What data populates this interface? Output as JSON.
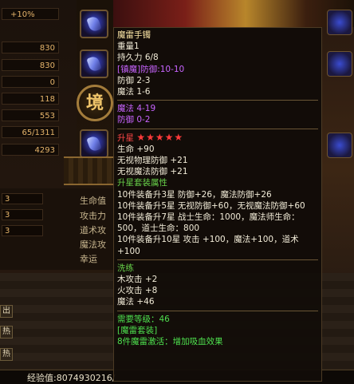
{
  "left_stats": [
    "+10%",
    "830",
    "830",
    "0",
    "118",
    "553",
    "65/1311",
    "4293"
  ],
  "mini_stats": [
    "3",
    "3",
    "3"
  ],
  "stat_labels": [
    "生命值",
    "攻击力",
    "道术攻",
    "魔法攻",
    "幸运"
  ],
  "jing_button": "境",
  "bottom_buttons": [
    "出",
    "热",
    "热"
  ],
  "exp_label": "经验值:8074930216/",
  "tooltip": {
    "name": "魔雷手镯",
    "weight": "重量1",
    "durability": "持久力 6/8",
    "refine": "[镇魔]防御:10-10",
    "defense": "防御 2-3",
    "magic": "魔法 1-6",
    "magic_bonus": "魔法 4-19",
    "defense_bonus": "防御 0-2",
    "upgrade_star_label": "升星",
    "stars": "★★★★★",
    "star_lines": [
      "生命 +90",
      "无视物理防御 +21",
      "无视魔法防御 +21"
    ],
    "set_header": "升星套装属性",
    "set_lines": [
      "10件装备升3星 防御+26，魔法防御+26",
      "10件装备升5星 无视防御+60，无视魔法防御+60",
      "10件装备升7星 战士生命：1000，魔法师生命：500，道士生命：800",
      "10件装备升10星 攻击 +100，魔法+100，道术+100"
    ],
    "refine_header": "洗练",
    "refine_lines": [
      "木攻击 +2",
      "火攻击 +8",
      "魔法 +46"
    ],
    "level_req": "需要等级：46",
    "set_name": "[魔雷套装]",
    "set_effect": "8件魔雷激活：增加吸血效果"
  }
}
